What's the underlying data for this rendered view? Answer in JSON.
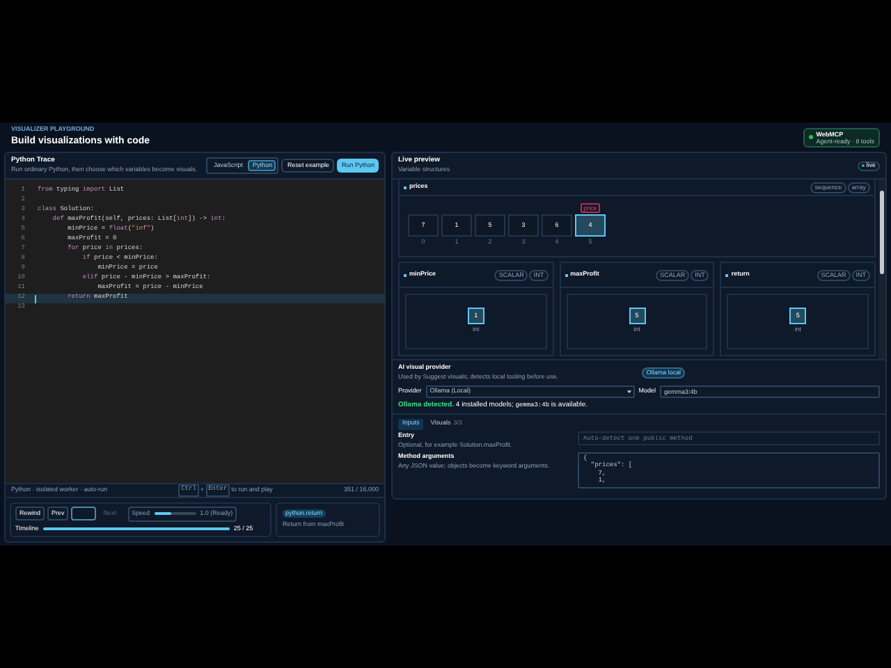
{
  "header": {
    "eyebrow": "VISUALIZER PLAYGROUND",
    "title": "Build visualizations with code",
    "badge": {
      "title": "WebMCP",
      "subtitle": "Agent-ready · 8 tools",
      "color": "#22c55e"
    }
  },
  "editor": {
    "title": "Python Trace",
    "subtitle": "Run ordinary Python, then choose which variables become visuals.",
    "languages": [
      {
        "label": "JavaScript",
        "selected": false
      },
      {
        "label": "Python",
        "selected": true
      }
    ],
    "reset": "Reset example",
    "run": "Run Python",
    "lines": [
      {
        "number": "1",
        "tokens": [
          {
            "text": "from",
            "kind": "kw"
          },
          {
            "text": " typing ",
            "kind": "pl"
          },
          {
            "text": "import",
            "kind": "kw"
          },
          {
            "text": " List",
            "kind": "pl"
          }
        ],
        "current": false
      },
      {
        "number": "2",
        "current": false
      },
      {
        "number": "3",
        "tokens": [
          {
            "text": "class",
            "kind": "kw"
          },
          {
            "text": " Solution:",
            "kind": "pl"
          }
        ],
        "current": false
      },
      {
        "number": "4",
        "tokens": [
          {
            "text": "    def",
            "kind": "kw"
          },
          {
            "text": " maxProfit(self, prices: List[",
            "kind": "pl"
          },
          {
            "text": "int",
            "kind": "kw"
          },
          {
            "text": "]) -> ",
            "kind": "pl"
          },
          {
            "text": "int",
            "kind": "kw"
          },
          {
            "text": ":",
            "kind": "pl"
          }
        ],
        "current": false
      },
      {
        "number": "5",
        "tokens": [
          {
            "text": "        minPrice = ",
            "kind": "pl"
          },
          {
            "text": "float",
            "kind": "kw"
          },
          {
            "text": "(",
            "kind": "pl"
          },
          {
            "text": "\"inf\"",
            "kind": "str"
          },
          {
            "text": ")",
            "kind": "pl"
          }
        ],
        "current": false
      },
      {
        "number": "6",
        "tokens": [
          {
            "text": "        maxProfit = 0",
            "kind": "pl"
          }
        ],
        "current": false
      },
      {
        "number": "7",
        "tokens": [
          {
            "text": "        for",
            "kind": "kw"
          },
          {
            "text": " price ",
            "kind": "pl"
          },
          {
            "text": "in",
            "kind": "kw"
          },
          {
            "text": " prices:",
            "kind": "pl"
          }
        ],
        "current": false
      },
      {
        "number": "8",
        "tokens": [
          {
            "text": "            if",
            "kind": "kw"
          },
          {
            "text": " price < minPrice:",
            "kind": "pl"
          }
        ],
        "current": false
      },
      {
        "number": "9",
        "tokens": [
          {
            "text": "                minPrice = price",
            "kind": "pl"
          }
        ],
        "current": false
      },
      {
        "number": "10",
        "tokens": [
          {
            "text": "            elif",
            "kind": "kw"
          },
          {
            "text": " price - minPrice > maxProfit:",
            "kind": "pl"
          }
        ],
        "current": false
      },
      {
        "number": "11",
        "tokens": [
          {
            "text": "                maxProfit = price - minPrice",
            "kind": "pl"
          }
        ],
        "current": false
      },
      {
        "number": "12",
        "tokens": [
          {
            "text": "        return",
            "kind": "kw"
          },
          {
            "text": " maxProfit",
            "kind": "pl"
          }
        ],
        "current": true
      },
      {
        "number": "13",
        "current": false
      }
    ],
    "status": {
      "left": "Python · isolated worker · auto-run",
      "keys": [
        "Ctrl",
        "Enter"
      ],
      "plus": "+",
      "hint": "to run and play",
      "count": "351 / 16,000"
    }
  },
  "player": {
    "buttons": [
      {
        "label": "Rewind",
        "disabled": false
      },
      {
        "label": "Prev",
        "disabled": false
      },
      {
        "kind": "play",
        "disabled": false
      },
      {
        "label": "Next",
        "disabled": true
      }
    ],
    "speed": {
      "label": "Speed",
      "level": 0.4,
      "reading": "1.0 (Ready)"
    },
    "timeline": {
      "label": "Timeline",
      "level": 1,
      "reading": "25 / 25"
    },
    "event": {
      "tag": "python.return",
      "text": "Return from maxProfit"
    }
  },
  "preview": {
    "title": "Live preview",
    "subtitle": "Variable structures",
    "live": {
      "label": "live",
      "color": "#22c55e"
    },
    "array": {
      "name": "prices",
      "tags": [
        "sequence",
        "array"
      ],
      "pointer": "price",
      "cells": [
        {
          "value": "7",
          "index": "0",
          "selected": false
        },
        {
          "value": "1",
          "index": "1",
          "selected": false
        },
        {
          "value": "5",
          "index": "2",
          "selected": false
        },
        {
          "value": "3",
          "index": "3",
          "selected": false
        },
        {
          "value": "6",
          "index": "4",
          "selected": false
        },
        {
          "value": "4",
          "index": "5",
          "selected": true
        }
      ]
    },
    "scalars": [
      {
        "name": "minPrice",
        "tags": [
          "SCALAR",
          "INT"
        ],
        "value": "1",
        "type": "int"
      },
      {
        "name": "maxProfit",
        "tags": [
          "SCALAR",
          "INT"
        ],
        "value": "5",
        "type": "int"
      },
      {
        "name": "return",
        "tags": [
          "SCALAR",
          "INT"
        ],
        "value": "5",
        "type": "int"
      }
    ]
  },
  "ai": {
    "title": "AI visual provider",
    "subtitle": "Used by Suggest visuals; detects local tooling before use.",
    "pill": "Ollama local",
    "provider_label": "Provider",
    "provider": "Ollama (Local)",
    "model_label": "Model",
    "model": "gemma3:4b",
    "message_strong": "Ollama detected.",
    "message": " 4 installed models; ",
    "message_code": "gemma3:4b",
    "message_end": " is available."
  },
  "tabs": [
    {
      "label": "Inputs",
      "selected": true
    },
    {
      "label": "Visuals",
      "count": "3/3",
      "selected": false
    }
  ],
  "fields": [
    {
      "label": "Entry",
      "help": "Optional, for example Solution.maxProfit.",
      "placeholder": "Auto-detect one public method"
    },
    {
      "label": "Method arguments",
      "help": "Any JSON value; objects become keyword arguments.",
      "lines": [
        "{",
        "  \"prices\": [",
        "    7,",
        "    1,"
      ]
    }
  ]
}
